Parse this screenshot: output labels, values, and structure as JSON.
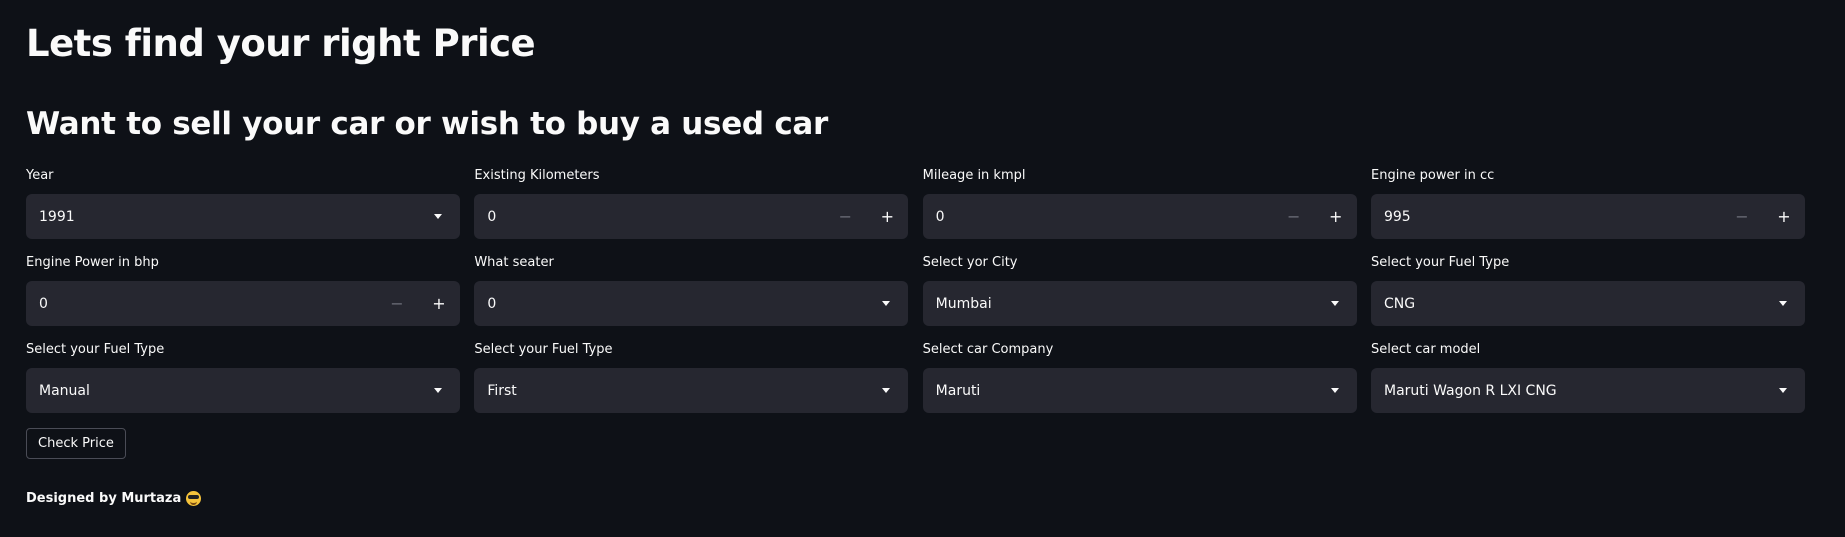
{
  "header": {
    "title": "Lets find your right Price",
    "subtitle": "Want to sell your car or wish to buy a used car"
  },
  "fields": [
    {
      "label": "Year",
      "type": "select",
      "value": "1991"
    },
    {
      "label": "Existing Kilometers",
      "type": "number",
      "value": "0"
    },
    {
      "label": "Mileage in kmpl",
      "type": "number",
      "value": "0"
    },
    {
      "label": "Engine power in cc",
      "type": "number",
      "value": "995"
    },
    {
      "label": "Engine Power in bhp",
      "type": "number",
      "value": "0"
    },
    {
      "label": "What seater",
      "type": "select",
      "value": "0"
    },
    {
      "label": "Select yor City",
      "type": "select",
      "value": "Mumbai"
    },
    {
      "label": "Select your Fuel Type",
      "type": "select",
      "value": "CNG"
    },
    {
      "label": "Select your Fuel Type",
      "type": "select",
      "value": "Manual"
    },
    {
      "label": "Select your Fuel Type",
      "type": "select",
      "value": "First"
    },
    {
      "label": "Select car Company",
      "type": "select",
      "value": "Maruti"
    },
    {
      "label": "Select car model",
      "type": "select",
      "value": "Maruti Wagon R LXI CNG"
    }
  ],
  "stepper": {
    "minus_symbol": "−",
    "plus_symbol": "+"
  },
  "actions": {
    "check_price_label": "Check Price"
  },
  "footer": {
    "text": "Designed by Murtaza",
    "emoji_icon": "smiling-face-with-sunglasses"
  },
  "colors": {
    "background": "#0e1117",
    "input_background": "#262730",
    "text": "#fafafa"
  }
}
